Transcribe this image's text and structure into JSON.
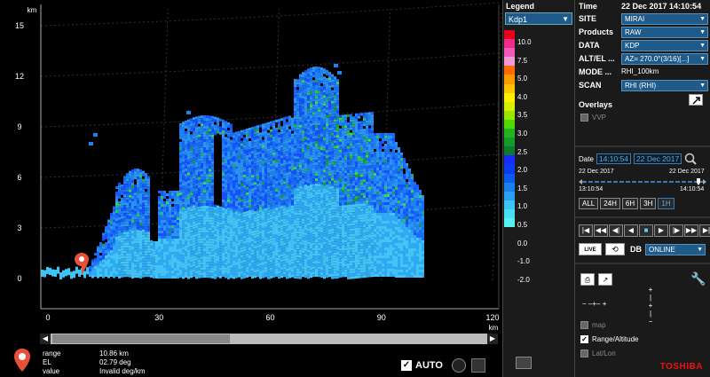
{
  "plot": {
    "y_unit": "km",
    "x_unit": "km",
    "y_ticks": [
      "15",
      "12",
      "9",
      "6",
      "3",
      "0"
    ],
    "x_ticks": [
      "0",
      "30",
      "60",
      "90",
      "120"
    ],
    "readout": {
      "rows": [
        {
          "key": "range",
          "value": "10.86 km"
        },
        {
          "key": "EL",
          "value": "02.79 deg"
        },
        {
          "key": "value",
          "value": "Invalid deg/km"
        }
      ]
    },
    "auto_label": "AUTO",
    "auto_checked": true
  },
  "legend": {
    "title": "Legend",
    "product": "Kdp1",
    "ticks": [
      "10.0",
      "7.5",
      "5.0",
      "4.0",
      "3.5",
      "3.0",
      "2.5",
      "2.0",
      "1.5",
      "1.0",
      "0.5",
      "0.0",
      "-1.0",
      "-2.0"
    ],
    "colors": [
      "#e8001a",
      "#ee2c8a",
      "#f05ab8",
      "#f39ad6",
      "#ff6a00",
      "#ff9a00",
      "#ffc300",
      "#fff000",
      "#d8f000",
      "#9ae600",
      "#4ed800",
      "#22b320",
      "#159a2a",
      "#0f7a2e",
      "#1b2bff",
      "#0a3df0",
      "#0a5cf0",
      "#1a80f0",
      "#2aa0f5",
      "#3cc4f5",
      "#48e0f7",
      "#5af0f0"
    ]
  },
  "controls": {
    "time_label": "Time",
    "time_value": "22 Dec 2017  14:10:54",
    "fields": [
      {
        "label": "SITE",
        "value": "MIRAI",
        "type": "select"
      },
      {
        "label": "Products",
        "value": "RAW",
        "type": "select"
      },
      {
        "label": "DATA",
        "value": "KDP",
        "type": "select"
      },
      {
        "label": "ALT/EL ...",
        "value": "AZ= 270.0°(3/16)[...]",
        "type": "select"
      },
      {
        "label": "MODE ...",
        "value": "RHI_100km",
        "type": "plain"
      },
      {
        "label": "SCAN",
        "value": "RHI (RHI)",
        "type": "select"
      }
    ],
    "overlays_title": "Overlays",
    "vvp_label": "VVP",
    "date_label": "Date",
    "date_time": "14:10:54",
    "date_day": "22 Dec 2017",
    "timeline_start_date": "22 Dec 2017",
    "timeline_end_date": "22 Dec 2017",
    "timeline_start_time": "13:10:54",
    "timeline_end_time": "14:10:54",
    "range_buttons": [
      "ALL",
      "24H",
      "6H",
      "3H",
      "1H"
    ],
    "range_active": "1H",
    "db_label": "DB",
    "db_value": "ONLINE",
    "live_label": "LIVE",
    "options": [
      {
        "label": "map",
        "checked": false
      },
      {
        "label": "Range/Altitude",
        "checked": true
      },
      {
        "label": "Lat/Lon",
        "checked": false
      }
    ],
    "brand": "TOSHIBA"
  }
}
